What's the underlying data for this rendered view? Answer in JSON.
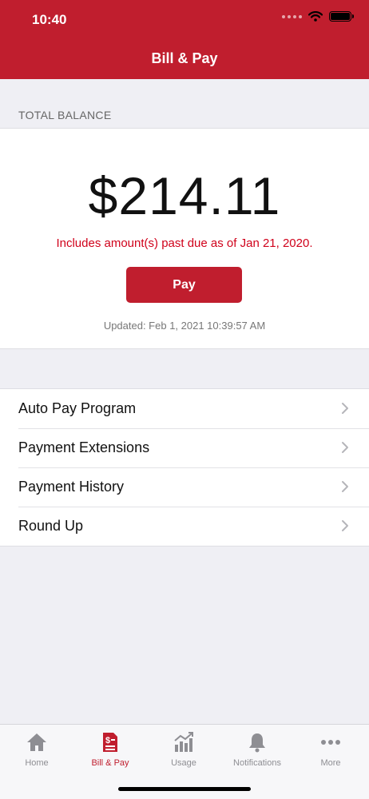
{
  "status_bar": {
    "time": "10:40"
  },
  "header": {
    "title": "Bill & Pay"
  },
  "balance": {
    "section_label": "TOTAL BALANCE",
    "amount": "$214.11",
    "past_due_note": "Includes amount(s) past due as of Jan 21, 2020.",
    "pay_label": "Pay",
    "updated": "Updated: Feb 1, 2021 10:39:57 AM"
  },
  "menu": {
    "items": [
      {
        "label": "Auto Pay Program"
      },
      {
        "label": "Payment Extensions"
      },
      {
        "label": "Payment History"
      },
      {
        "label": "Round Up"
      }
    ]
  },
  "tabbar": {
    "active": "Bill & Pay",
    "tabs": [
      {
        "label": "Home",
        "icon": "home-icon"
      },
      {
        "label": "Bill & Pay",
        "icon": "bill-icon"
      },
      {
        "label": "Usage",
        "icon": "usage-chart-icon"
      },
      {
        "label": "Notifications",
        "icon": "bell-icon"
      },
      {
        "label": "More",
        "icon": "more-dots-icon"
      }
    ]
  },
  "colors": {
    "brand": "#c01e2e",
    "alert": "#d0021b",
    "inactive": "#8e8e93"
  }
}
